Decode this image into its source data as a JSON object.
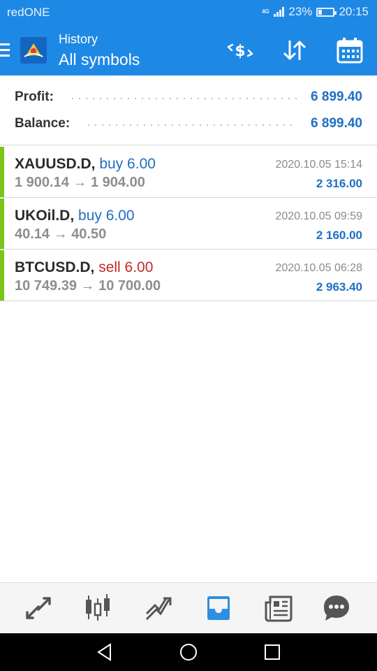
{
  "status_bar": {
    "carrier": "redONE",
    "network": "4G",
    "battery": "23%",
    "battery_level": 0.23,
    "time": "20:15"
  },
  "header": {
    "subtitle": "History",
    "title": "All symbols",
    "icons": [
      "menu-icon",
      "metatrader-logo",
      "deposit-withdrawal-icon",
      "sort-icon",
      "calendar-icon"
    ],
    "accent_color": "#1e88e5"
  },
  "summary": {
    "profit_label": "Profit:",
    "profit_value": "6 899.40",
    "balance_label": "Balance:",
    "balance_value": "6 899.40"
  },
  "trades": [
    {
      "symbol": "XAUUSD.D,",
      "side": "buy 6.00",
      "open_price": "1 900.14",
      "arrow": "→",
      "close_price": "1 904.00",
      "time": "2020.10.05 15:14",
      "profit": "2 316.00"
    },
    {
      "symbol": "UKOil.D,",
      "side": "buy 6.00",
      "open_price": "40.14",
      "arrow": "→",
      "close_price": "40.50",
      "time": "2020.10.05 09:59",
      "profit": "2 160.00"
    },
    {
      "symbol": "BTCUSD.D,",
      "side": "sell 6.00",
      "open_price": "10 749.39",
      "arrow": "→",
      "close_price": "10 700.00",
      "time": "2020.10.05 06:28",
      "profit": "2 963.40"
    }
  ],
  "bottom_nav": {
    "items": [
      "quotes-icon",
      "chart-candles-icon",
      "trade-icon",
      "history-inbox-icon",
      "news-icon",
      "chat-icon"
    ],
    "active": "history-inbox-icon",
    "active_color": "#2f8fe0",
    "inactive_color": "#555555"
  },
  "system_nav": {
    "items": [
      "back-icon",
      "home-icon",
      "recents-icon"
    ]
  },
  "colors": {
    "buy": "#1e6fc4",
    "sell": "#c62828",
    "profit_bar": "#7cc417"
  }
}
